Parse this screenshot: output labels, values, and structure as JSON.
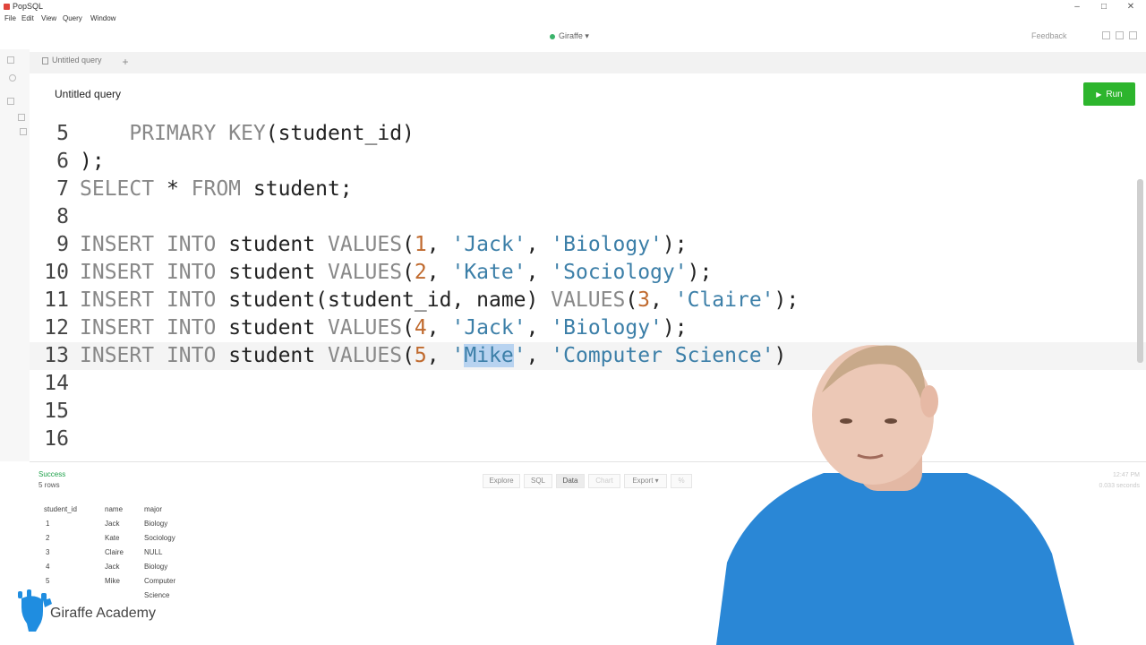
{
  "window": {
    "app_name": "PopSQL",
    "controls": [
      "–",
      "□",
      "✕"
    ]
  },
  "menu": [
    "File",
    "Edit",
    "View",
    "Query",
    "Window"
  ],
  "topbar": {
    "connection": "Giraffe ▾",
    "feedback": "Feedback"
  },
  "tabs": {
    "active": "Untitled query",
    "add": "+"
  },
  "query": {
    "title": "Untitled query",
    "run_label": "Run"
  },
  "editor": {
    "lines": [
      {
        "n": "5",
        "code": "    PRIMARY KEY(student_id)"
      },
      {
        "n": "6",
        "code": ");"
      },
      {
        "n": "7",
        "code": "SELECT * FROM student;"
      },
      {
        "n": "8",
        "code": ""
      },
      {
        "n": "9",
        "code": "INSERT INTO student VALUES(1, 'Jack', 'Biology');"
      },
      {
        "n": "10",
        "code": "INSERT INTO student VALUES(2, 'Kate', 'Sociology');"
      },
      {
        "n": "11",
        "code": "INSERT INTO student(student_id, name) VALUES(3, 'Claire');"
      },
      {
        "n": "12",
        "code": "INSERT INTO student VALUES(4, 'Jack', 'Biology');"
      },
      {
        "n": "13",
        "code": "INSERT INTO student VALUES(5, 'Mike', 'Computer Science')"
      },
      {
        "n": "14",
        "code": ""
      },
      {
        "n": "15",
        "code": ""
      },
      {
        "n": "16",
        "code": ""
      }
    ],
    "current_line": "13",
    "selected_text": "Mike"
  },
  "results": {
    "status": "Success",
    "row_count": "5 rows",
    "buttons": [
      "Explore",
      "SQL",
      "Data",
      "Chart",
      "Export ▾",
      "%"
    ],
    "active_button": "Data",
    "time": "12:47 PM",
    "duration": "0.033 seconds",
    "columns": [
      "student_id",
      "name",
      "major"
    ],
    "rows": [
      [
        "1",
        "Jack",
        "Biology"
      ],
      [
        "2",
        "Kate",
        "Sociology"
      ],
      [
        "3",
        "Claire",
        "NULL"
      ],
      [
        "4",
        "Jack",
        "Biology"
      ],
      [
        "5",
        "Mike",
        "Computer Science"
      ]
    ]
  },
  "brand": {
    "name": "Giraffe Academy",
    "logo_color": "#1f8de0"
  },
  "colors": {
    "run_button": "#2db52d",
    "success": "#1ea14a",
    "keyword": "#888888",
    "string": "#3c7fa8",
    "number": "#c06a2e",
    "selection": "#b8d3f0",
    "shirt": "#2a87d6"
  }
}
